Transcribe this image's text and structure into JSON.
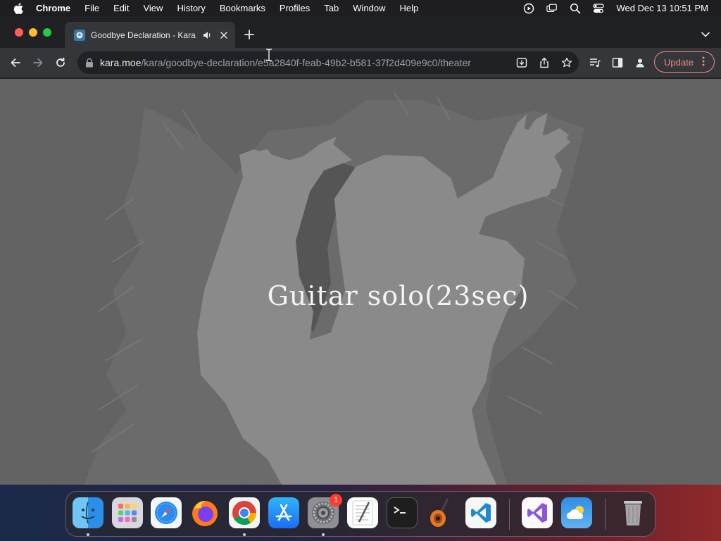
{
  "menubar": {
    "app_name": "Chrome",
    "items": [
      "File",
      "Edit",
      "View",
      "History",
      "Bookmarks",
      "Profiles",
      "Tab",
      "Window",
      "Help"
    ],
    "clock": "Wed Dec 13  10:51 PM",
    "status_icons": [
      "screen-recording-icon",
      "window-icon",
      "spotlight-search-icon",
      "control-center-icon"
    ]
  },
  "browser": {
    "tab": {
      "title": "Goodbye Declaration - Kara",
      "favicon": "kara-favicon-icon",
      "audio_icon": "speaker-icon",
      "close_icon": "close-icon"
    },
    "new_tab_icon": "plus-icon",
    "tab_search_icon": "chevron-down-icon",
    "omnibox": {
      "host": "kara.moe",
      "path": "/kara/goodbye-declaration/e5a2840f-feab-49b2-b581-37f2d409e9c0/theater"
    },
    "update_button": "Update",
    "colors": {
      "update": "#f28b82",
      "background": "#202124",
      "toolbar": "#35363a"
    }
  },
  "content": {
    "caption": "Guitar solo(23sec)",
    "background_color": "#636363"
  },
  "dock": {
    "apps": [
      {
        "name": "Finder",
        "icon": "finder-icon",
        "running": true
      },
      {
        "name": "Launchpad",
        "icon": "launchpad-icon",
        "running": false
      },
      {
        "name": "Safari",
        "icon": "safari-icon",
        "running": false
      },
      {
        "name": "Firefox",
        "icon": "firefox-icon",
        "running": false
      },
      {
        "name": "Google Chrome",
        "icon": "chrome-icon",
        "running": true
      },
      {
        "name": "App Store",
        "icon": "app-store-icon",
        "running": false
      },
      {
        "name": "System Settings",
        "icon": "system-settings-icon",
        "running": true,
        "badge": "1"
      },
      {
        "name": "TextEdit",
        "icon": "textedit-icon",
        "running": false
      },
      {
        "name": "Terminal",
        "icon": "terminal-icon",
        "running": false
      },
      {
        "name": "GarageBand",
        "icon": "garageband-icon",
        "running": false
      },
      {
        "name": "Visual Studio Code",
        "icon": "vscode-icon",
        "running": false
      },
      {
        "name": "Visual Studio",
        "icon": "visual-studio-icon",
        "running": false
      },
      {
        "name": "Weather",
        "icon": "weather-icon",
        "running": false
      },
      {
        "name": "Trash",
        "icon": "trash-icon",
        "running": false
      }
    ]
  }
}
